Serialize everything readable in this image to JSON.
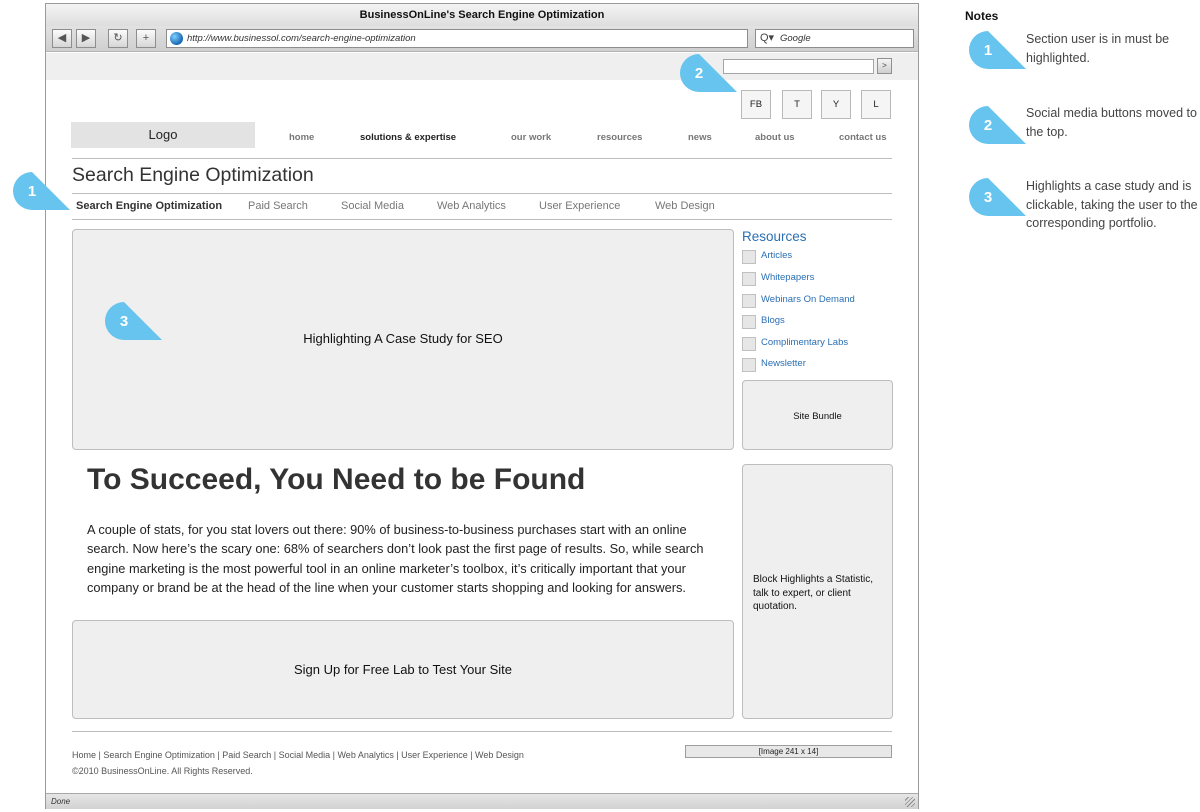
{
  "browser": {
    "title": "BusinessOnLine's Search Engine Optimization",
    "url": "http://www.businessol.com/search-engine-optimization",
    "search_placeholder": "Google",
    "status": "Done",
    "nav_buttons": [
      "◀",
      "▶",
      "↻",
      "+"
    ]
  },
  "site": {
    "search_go": ">",
    "social": [
      "FB",
      "T",
      "Y",
      "L"
    ],
    "logo": "Logo",
    "main_nav": [
      "home",
      "solutions & expertise",
      "our work",
      "resources",
      "news",
      "about us",
      "contact us"
    ],
    "page_title": "Search Engine Optimization",
    "sub_nav": [
      "Search Engine Optimization",
      "Paid Search",
      "Social Media",
      "Web Analytics",
      "User Experience",
      "Web Design"
    ],
    "case_study": "Highlighting A Case Study for SEO",
    "resources": {
      "title": "Resources",
      "items": [
        "Articles",
        "Whitepapers",
        "Webinars On Demand",
        "Blogs",
        "Complimentary Labs",
        "Newsletter"
      ]
    },
    "site_bundle": "Site Bundle",
    "headline": "To Succeed, You Need to be Found",
    "body": "A couple of stats, for you stat lovers out there: 90% of business-to-business purchases start with an online search. Now here’s the scary one: 68% of searchers don’t look past the first page of results. So, while search engine marketing is the most powerful tool in an online marketer’s toolbox, it’s critically important that your company or brand be at the head of the line when your customer starts shopping and looking for answers.",
    "highlight_block": "Block Highlights a Statistic, talk to expert, or client quotation.",
    "signup": "Sign Up for Free Lab to Test Your Site",
    "footer_links": "Home  |  Search Engine Optimization  |  Paid Search  |  Social Media  |  Web Analytics  |  User Experience  |  Web Design",
    "copyright": "©2010 BusinessOnLine. All Rights Reserved.",
    "footer_image": "[Image 241 x 14]"
  },
  "callouts": [
    "1",
    "2",
    "3"
  ],
  "notes": {
    "title": "Notes",
    "items": [
      {
        "number": "1",
        "text": "Section user is in must be highlighted."
      },
      {
        "number": "2",
        "text": "Social media buttons moved to the top."
      },
      {
        "number": "3",
        "text": "Highlights a case study and is clickable, taking the user to the corresponding portfolio."
      }
    ]
  },
  "colors": {
    "callout": "#67c4ee",
    "link": "#2a6fb4",
    "box": "#efefef"
  }
}
